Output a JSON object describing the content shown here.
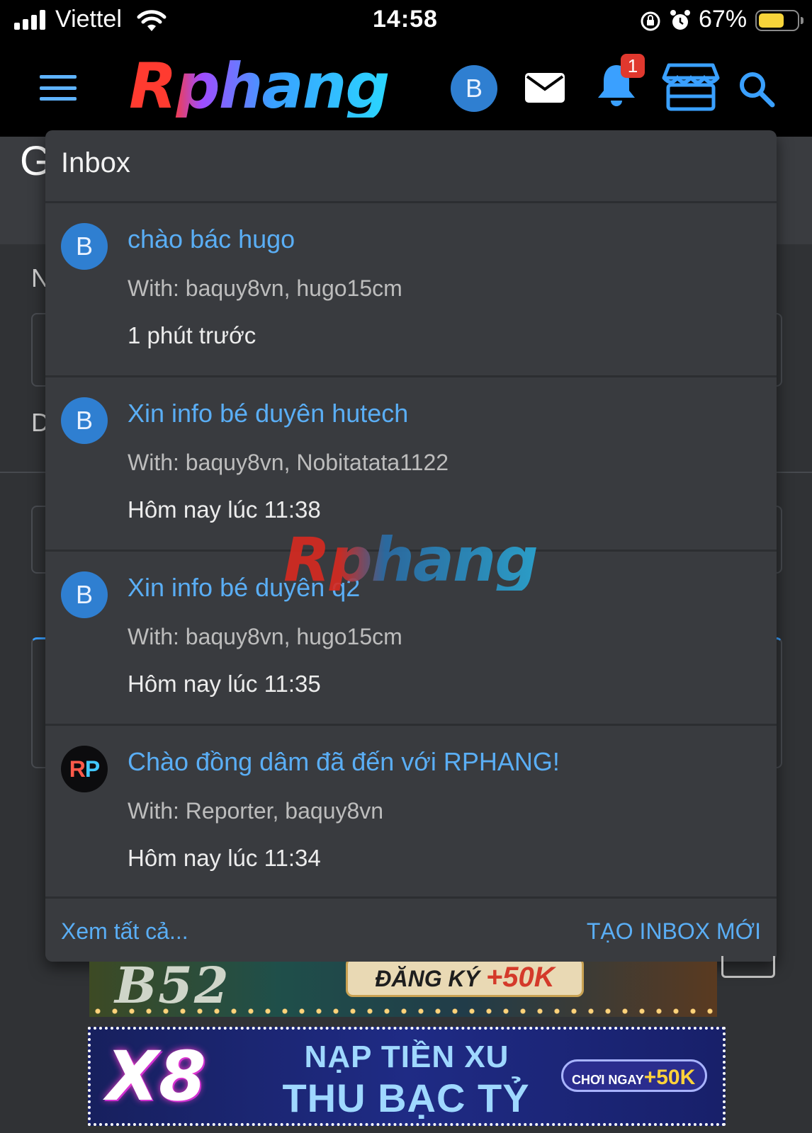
{
  "status_bar": {
    "carrier": "Viettel",
    "time": "14:58",
    "battery_percent": "67%",
    "battery_level": 0.67
  },
  "header": {
    "logo": "Rphang",
    "avatar_letter": "B",
    "notification_count": "1",
    "icons": [
      "menu-icon",
      "mail-icon",
      "bell-icon",
      "store-icon",
      "search-icon"
    ]
  },
  "page": {
    "title_initial": "G",
    "side_letters": [
      "N",
      "D"
    ]
  },
  "inbox": {
    "title": "Inbox",
    "messages": [
      {
        "avatar": "B",
        "title": "chào bác hugo",
        "with": "With: baquy8vn, hugo15cm",
        "time": "1 phút trước"
      },
      {
        "avatar": "B",
        "title": "Xin info bé duyên hutech",
        "with": "With: baquy8vn, Nobitatata1122",
        "time": "Hôm nay lúc 11:38"
      },
      {
        "avatar": "B",
        "title": "Xin info bé duyên q2",
        "with": "With: baquy8vn, hugo15cm",
        "time": "Hôm nay lúc 11:35"
      },
      {
        "avatar_r": "R",
        "avatar_p": "P",
        "title": "Chào đồng dâm đã đến với RPHANG!",
        "with": "With: Reporter, baquy8vn",
        "time": "Hôm nay lúc 11:34"
      }
    ],
    "see_all": "Xem tất cả...",
    "new_inbox": "TẠO INBOX MỚI"
  },
  "watermark": "Rphang",
  "ads": {
    "banner1": {
      "brand": "B52",
      "text": "ĐĂNG KÝ",
      "bonus": "+50K"
    },
    "banner2": {
      "brand": "X8",
      "line1": "NẠP TIỀN XU",
      "line2": "THU BẠC TỶ",
      "cta": "CHƠI NGAY",
      "cta_bonus": "+50K"
    }
  },
  "colors": {
    "accent": "#5aaef5",
    "avatar_bg": "#2f7fd1",
    "panel_bg": "#393b3f",
    "page_bg": "#303235",
    "badge": "#e0382e"
  }
}
